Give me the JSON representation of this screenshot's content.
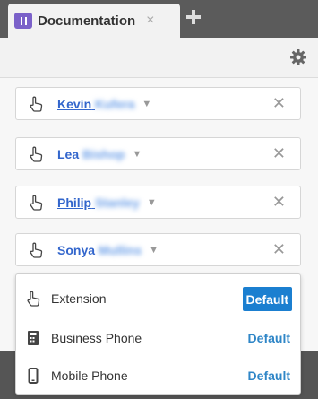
{
  "tab": {
    "title": "Documentation",
    "close": "×",
    "add": "+"
  },
  "toolbar": {
    "settings_icon": "gear-icon"
  },
  "contacts": [
    {
      "first": "Kevin",
      "last": "Kufera",
      "remove": "✕"
    },
    {
      "first": "Lea",
      "last": "Bishop",
      "remove": "✕"
    },
    {
      "first": "Philip",
      "last": "Stanley",
      "remove": "✕"
    },
    {
      "first": "Sonya",
      "last": "Mullins",
      "remove": "✕"
    }
  ],
  "caret": "▼",
  "dropdown": {
    "options": [
      {
        "label": "Extension",
        "default": "Default",
        "icon": "hand-pointer-icon",
        "selected": true
      },
      {
        "label": "Business Phone",
        "default": "Default",
        "icon": "desk-phone-icon",
        "selected": false
      },
      {
        "label": "Mobile Phone",
        "default": "Default",
        "icon": "mobile-phone-icon",
        "selected": false
      }
    ]
  },
  "colors": {
    "accent": "#1b7fd0",
    "link": "#3366cc",
    "tab_icon": "#7b61c9"
  }
}
